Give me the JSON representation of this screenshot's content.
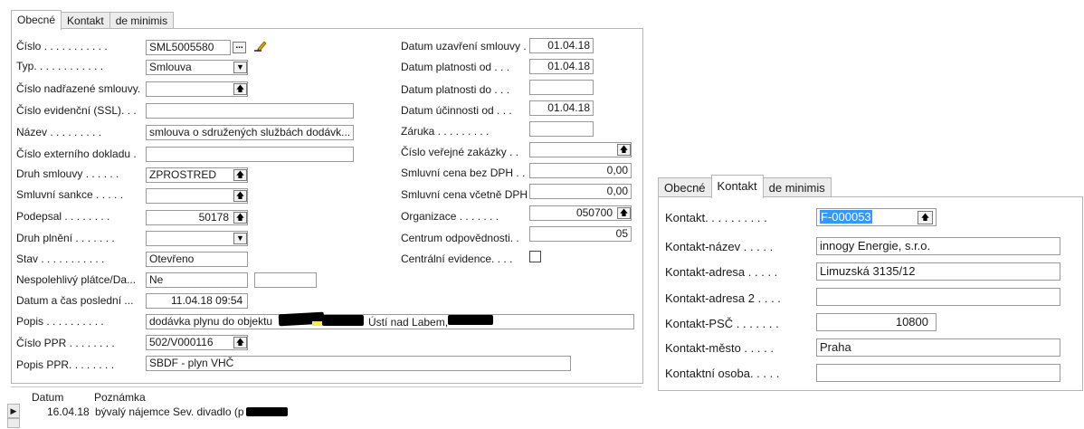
{
  "left": {
    "tabs": [
      "Obecné",
      "Kontakt",
      "de minimis"
    ],
    "left_fields": [
      {
        "label": "Číslo . . . . . . . . . . .",
        "value": "SML5005580"
      },
      {
        "label": "Typ. . . . . . . . . . . .",
        "value": "Smlouva"
      },
      {
        "label": "Číslo nadřazené smlouvy.",
        "value": ""
      },
      {
        "label": "Číslo evidenční (SSL). . .",
        "value": ""
      },
      {
        "label": "Název . . . . . . . . .",
        "value": "smlouva o sdružených službách dodávk..."
      },
      {
        "label": "Číslo externího dokladu .",
        "value": ""
      },
      {
        "label": "Druh smlouvy . . . . . .",
        "value": "ZPROSTRED"
      },
      {
        "label": "Smluvní sankce . . . . .",
        "value": ""
      },
      {
        "label": "Podepsal . . . . . . . .",
        "value": "50178"
      },
      {
        "label": "Druh plnění . . . . . . .",
        "value": ""
      },
      {
        "label": "Stav . . . . . . . . . . .",
        "value": "Otevřeno"
      },
      {
        "label": "Nespolehlivý plátce/Da...",
        "value": "Ne"
      },
      {
        "label": "Datum a čas poslední ...",
        "value": "11.04.18 09:54"
      },
      {
        "label": "Popis . . . . . . . . . .",
        "value_a": "dodávka plynu do objektu",
        "value_b": "Ústí nad Labem,"
      },
      {
        "label": "Číslo PPR . . . . . . . .",
        "value": "502/V000116"
      },
      {
        "label": "Popis PPR. . . . . . . .",
        "value": "SBDF - plyn VHČ"
      }
    ],
    "right_fields": [
      {
        "label": "Datum uzavření smlouvy .",
        "value": "01.04.18"
      },
      {
        "label": "Datum platnosti od . . .",
        "value": "01.04.18"
      },
      {
        "label": "Datum platnosti do . . .",
        "value": ""
      },
      {
        "label": "Datum účinnosti od . . .",
        "value": "01.04.18"
      },
      {
        "label": "Záruka . . . . . . . . .",
        "value": ""
      },
      {
        "label": "Číslo veřejné zakázky . .",
        "value": ""
      },
      {
        "label": "Smluvní cena bez DPH . .",
        "value": "0,00"
      },
      {
        "label": "Smluvní cena včetně DPH",
        "value": "0,00"
      },
      {
        "label": "Organizace . . . . . . .",
        "value": "050700"
      },
      {
        "label": "Centrum odpovědnosti. .",
        "value": "05"
      },
      {
        "label": "Centrální evidence. . . .",
        "value": ""
      }
    ],
    "notes": {
      "headers": [
        "Datum",
        "Poznámka"
      ],
      "rows": [
        {
          "date": "16.04.18",
          "note": "bývalý nájemce Sev. divadlo (p"
        }
      ]
    }
  },
  "right": {
    "tabs": [
      "Obecné",
      "Kontakt",
      "de minimis"
    ],
    "fields": [
      {
        "label": "Kontakt. . . . . . . . . .",
        "value": "F-000053"
      },
      {
        "label": "Kontakt-název . . . . .",
        "value": "innogy Energie, s.r.o."
      },
      {
        "label": "Kontakt-adresa . . . . .",
        "value": "Limuzská 3135/12"
      },
      {
        "label": "Kontakt-adresa 2 . . . .",
        "value": ""
      },
      {
        "label": "Kontakt-PSČ . . . . . . .",
        "value": "10800"
      },
      {
        "label": "Kontakt-město . . . . .",
        "value": "Praha"
      },
      {
        "label": "Kontaktní osoba. . . . .",
        "value": ""
      }
    ]
  },
  "icons": {
    "lookup": "ellipsis-button",
    "edit": "pencil-icon",
    "dropdown": "dropdown-arrow",
    "assist": "assist-up-arrow"
  },
  "colors": {
    "selection": "#3399ff",
    "highlight": "#f3ee3c",
    "tab_bg": "#ececec"
  }
}
